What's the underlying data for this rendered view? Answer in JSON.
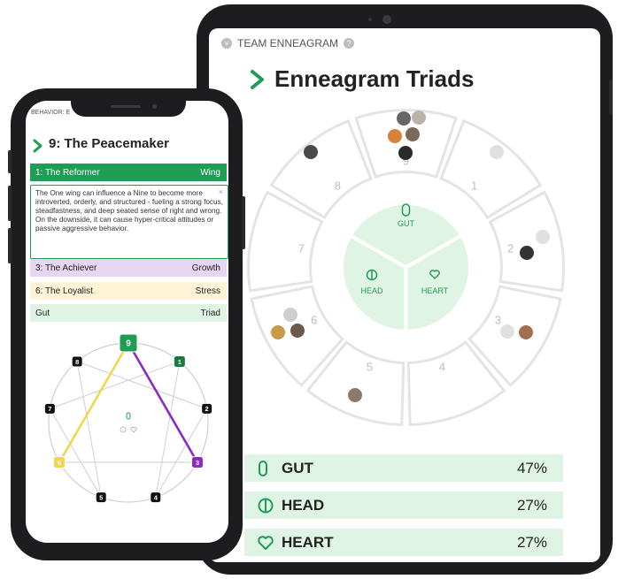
{
  "tablet": {
    "header_label": "TEAM ENNEAGRAM",
    "title": "Enneagram Triads",
    "wheel": {
      "numbers": [
        "9",
        "1",
        "2",
        "3",
        "4",
        "5",
        "6",
        "7",
        "8"
      ],
      "triads": [
        {
          "name": "GUT"
        },
        {
          "name": "HEAD"
        },
        {
          "name": "HEART"
        }
      ]
    },
    "rows": [
      {
        "label": "GUT",
        "percent": "47%",
        "icon": "gut-icon"
      },
      {
        "label": "HEAD",
        "percent": "27%",
        "icon": "head-icon"
      },
      {
        "label": "HEART",
        "percent": "27%",
        "icon": "heart-icon"
      }
    ]
  },
  "phone": {
    "top_label": "BEHAVIOR: E",
    "title": "9: The Peacemaker",
    "wing_row": {
      "label": "1: The Reformer",
      "right": "Wing"
    },
    "description": "The One wing can influence a Nine to become more introverted, orderly, and structured - fueling a strong focus, steadfastness, and deep seated sense of right and wrong. On the downside, it can cause hyper-critical attitudes or passive aggressive behavior.",
    "rows": [
      {
        "label": "3: The Achiever",
        "right": "Growth"
      },
      {
        "label": "6: The Loyalist",
        "right": "Stress"
      },
      {
        "label": "Gut",
        "right": "Triad"
      }
    ],
    "diagram_nodes": [
      "9",
      "1",
      "2",
      "3",
      "4",
      "5",
      "6",
      "7",
      "8"
    ]
  },
  "colors": {
    "green": "#1f9d55",
    "light_green": "#dff4e4",
    "purple": "#8a2bc2",
    "light_purple": "#e6d5f3",
    "yellow": "#f2d64e",
    "light_yellow": "#fdf3d6"
  }
}
